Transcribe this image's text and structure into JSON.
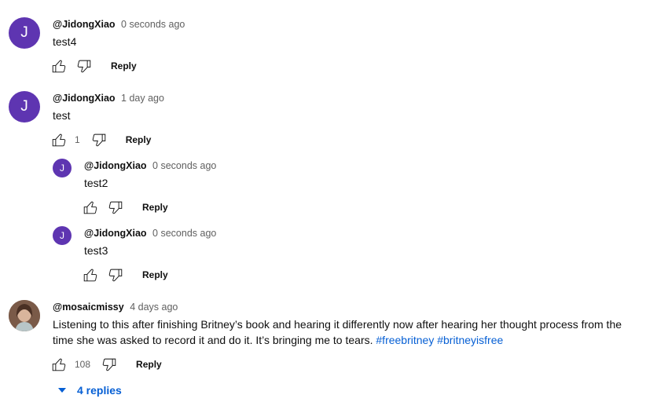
{
  "colors": {
    "avatar_purple": "#5e35b1",
    "link_blue": "#065fd4",
    "meta_gray": "#606060"
  },
  "comments": [
    {
      "avatar_letter": "J",
      "author": "@JidongXiao",
      "time": "0 seconds ago",
      "text": "test4",
      "likes": "",
      "reply_label": "Reply"
    },
    {
      "avatar_letter": "J",
      "author": "@JidongXiao",
      "time": "1 day ago",
      "text": "test",
      "likes": "1",
      "reply_label": "Reply",
      "replies": [
        {
          "avatar_letter": "J",
          "author": "@JidongXiao",
          "time": "0 seconds ago",
          "text": "test2",
          "reply_label": "Reply"
        },
        {
          "avatar_letter": "J",
          "author": "@JidongXiao",
          "time": "0 seconds ago",
          "text": "test3",
          "reply_label": "Reply"
        }
      ]
    },
    {
      "author": "@mosaicmissy",
      "time": "4 days ago",
      "text_line1": "Listening to this after finishing Britney’s book and hearing it differently now after hearing her thought process from the",
      "text_line2": "time she was asked to record it and do it. It’s bringing me to tears. ",
      "hashtag1": "#freebritney",
      "hashtag2": "#britneyisfree",
      "likes": "108",
      "reply_label": "Reply",
      "replies_toggle": "4 replies"
    }
  ],
  "icons": {
    "like": "thumbs-up-icon",
    "dislike": "thumbs-down-icon",
    "expand": "caret-down-icon"
  }
}
